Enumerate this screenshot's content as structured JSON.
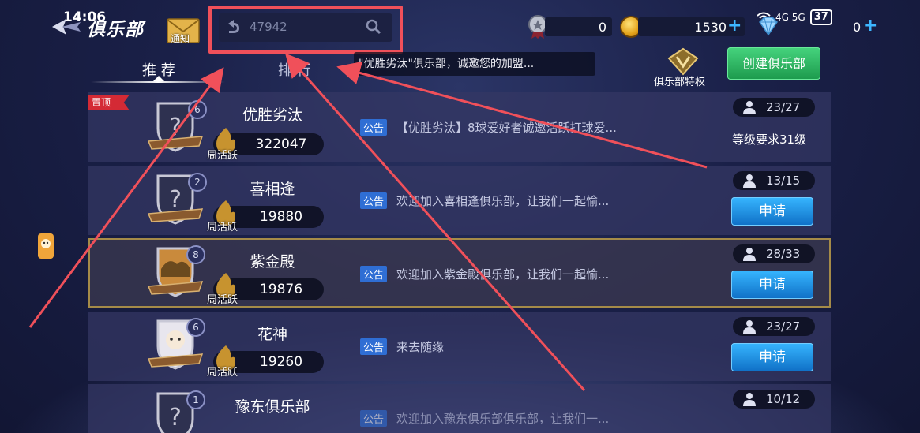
{
  "status_bar": {
    "time": "14:06",
    "network": "4G 5G",
    "battery": "37"
  },
  "header": {
    "title": "俱乐部",
    "notice_label": "通知",
    "search_value": "47942",
    "currency1": "0",
    "currency2": "1530",
    "currency3": "0"
  },
  "tabs": {
    "recommend": "推 荐",
    "rank": "排 行"
  },
  "ticker": "\"优胜劣汰\"俱乐部，诚邀您的加盟...",
  "privilege_label": "俱乐部特权",
  "create_button": "创建俱乐部",
  "pin_label": "置顶",
  "notice_tag": "公告",
  "activity_label": "周活跃",
  "apply_label": "申请",
  "clubs": [
    {
      "name": "优胜劣汰",
      "level": "6",
      "activity": "322047",
      "notice": "【优胜劣汰】8球爱好者诚邀活跃打球爱...",
      "members": "23/27",
      "requirement": "等级要求31级"
    },
    {
      "name": "喜相逢",
      "level": "2",
      "activity": "19880",
      "notice": "欢迎加入喜相逢俱乐部，让我们一起愉...",
      "members": "13/15"
    },
    {
      "name": "紫金殿",
      "level": "8",
      "activity": "19876",
      "notice": "欢迎加入紫金殿俱乐部，让我们一起愉...",
      "members": "28/33"
    },
    {
      "name": "花神",
      "level": "6",
      "activity": "19260",
      "notice": "来去随缘",
      "members": "23/27"
    },
    {
      "name": "豫东俱乐部",
      "level": "1",
      "notice": "欢迎加入豫东俱乐部俱乐部，让我们一...",
      "members": "10/12"
    }
  ],
  "colors": {
    "annotation": "#f0505a",
    "apply_button": "#1a8be0",
    "create_button": "#27b35f"
  }
}
